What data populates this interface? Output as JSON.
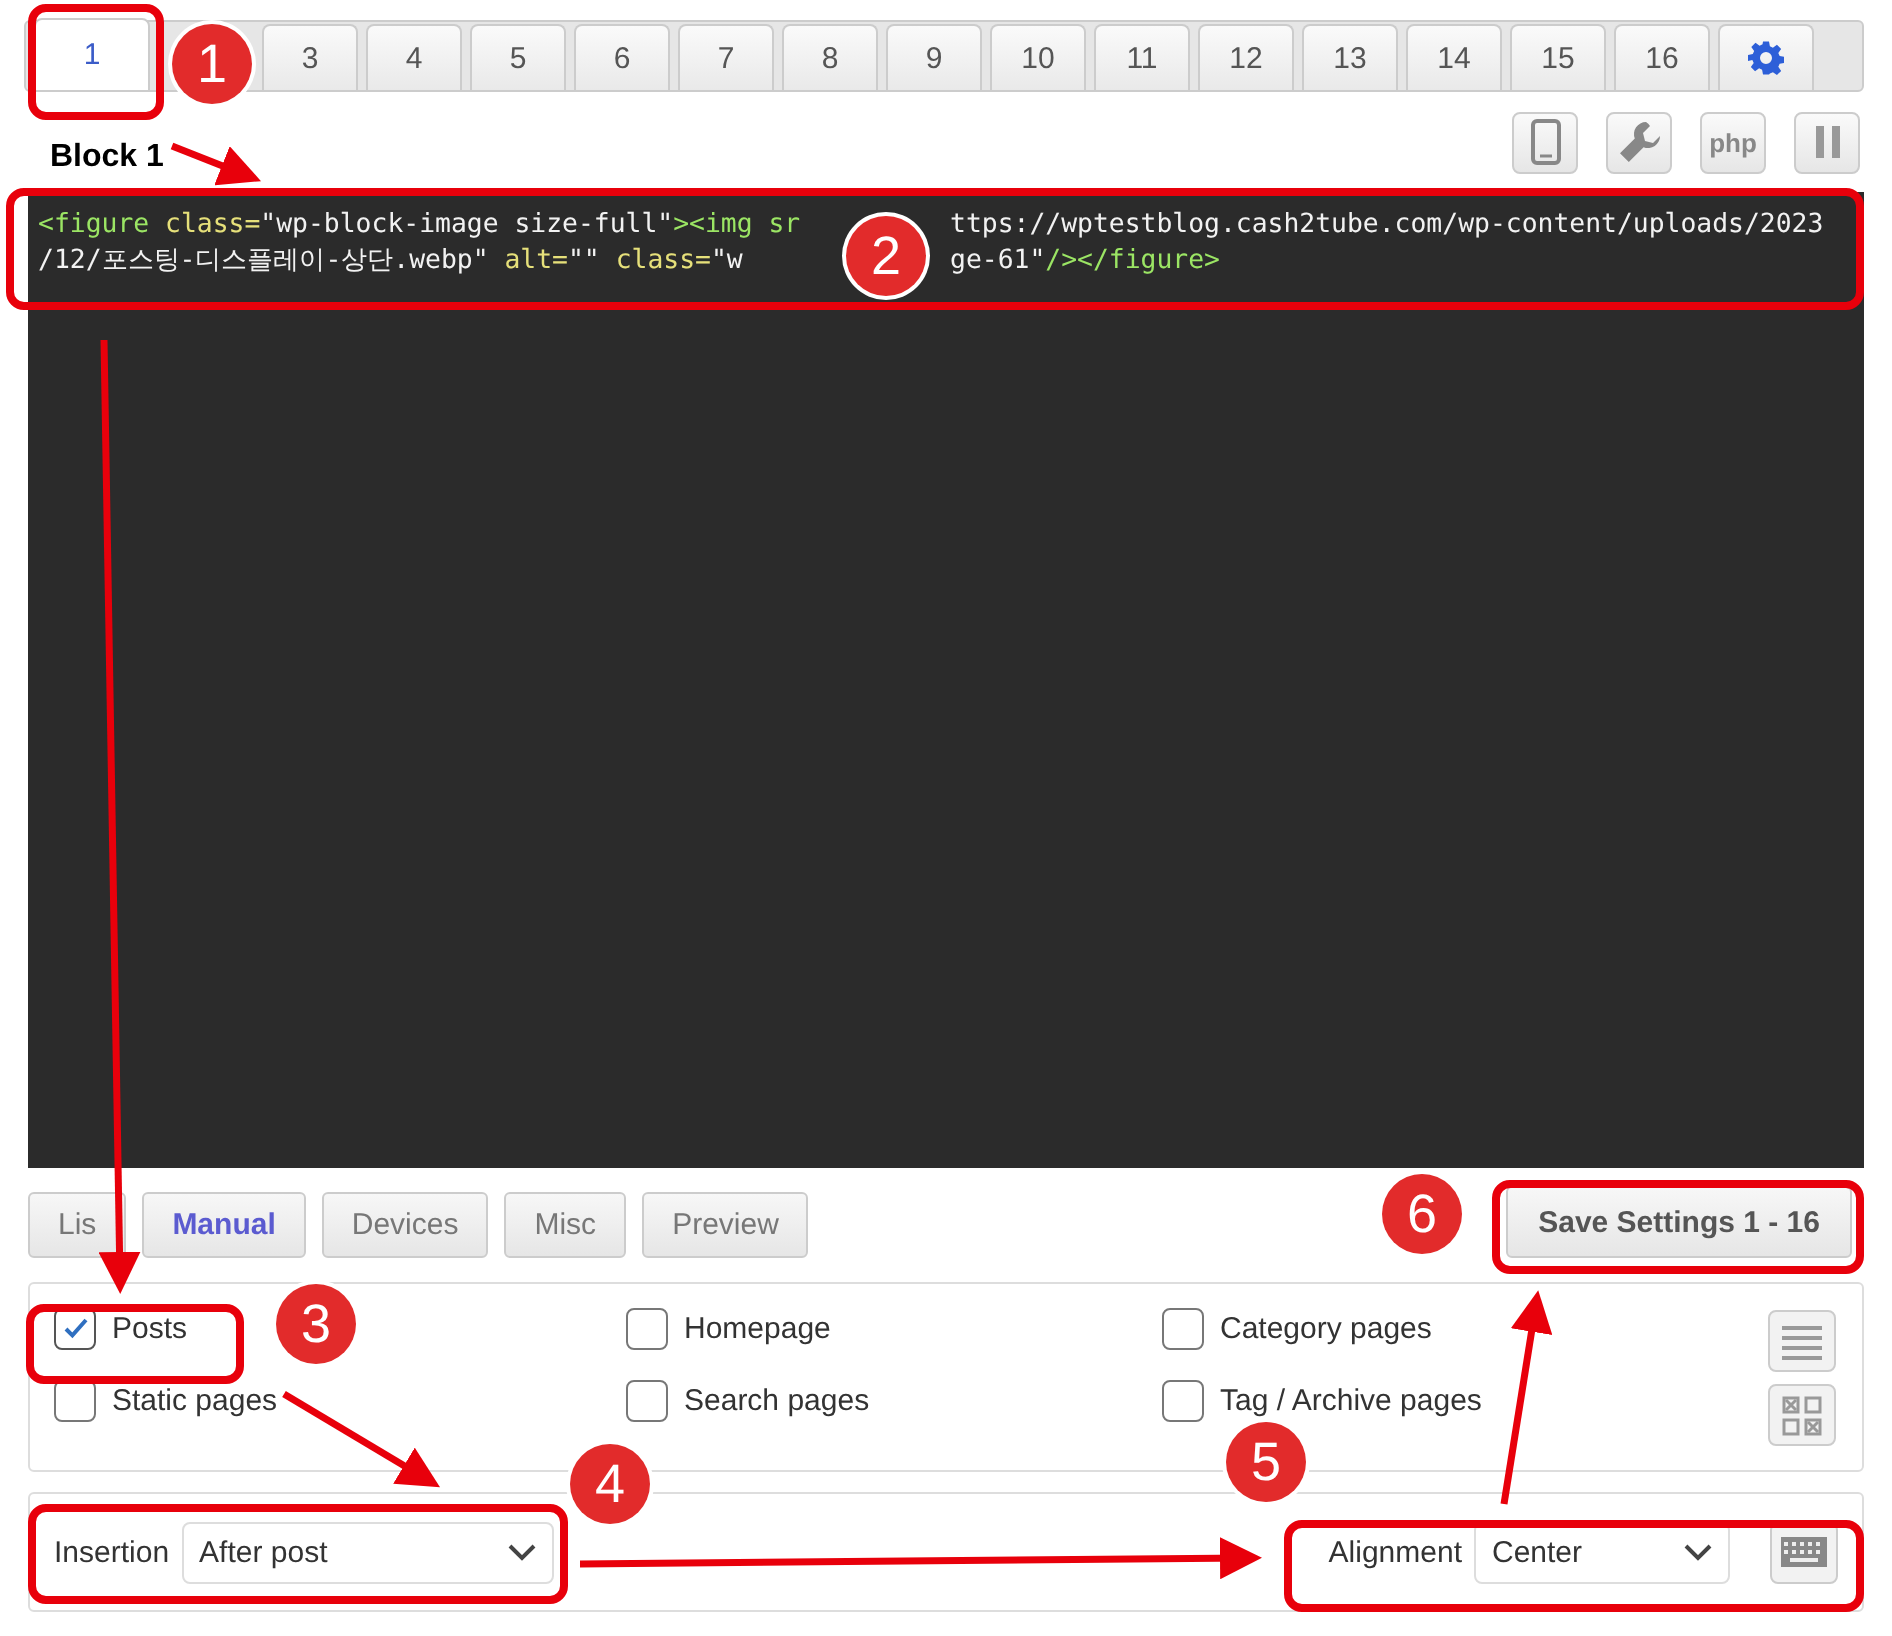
{
  "tabs": [
    {
      "label": "1",
      "selected": true,
      "kind": "number"
    },
    {
      "label": "3",
      "selected": false,
      "kind": "number"
    },
    {
      "label": "4",
      "selected": false,
      "kind": "number"
    },
    {
      "label": "5",
      "selected": false,
      "kind": "number"
    },
    {
      "label": "6",
      "selected": false,
      "kind": "number"
    },
    {
      "label": "7",
      "selected": false,
      "kind": "number"
    },
    {
      "label": "8",
      "selected": false,
      "kind": "number"
    },
    {
      "label": "9",
      "selected": false,
      "kind": "number"
    },
    {
      "label": "10",
      "selected": false,
      "kind": "number"
    },
    {
      "label": "11",
      "selected": false,
      "kind": "number"
    },
    {
      "label": "12",
      "selected": false,
      "kind": "number"
    },
    {
      "label": "13",
      "selected": false,
      "kind": "number"
    },
    {
      "label": "14",
      "selected": false,
      "kind": "number"
    },
    {
      "label": "15",
      "selected": false,
      "kind": "number"
    },
    {
      "label": "16",
      "selected": false,
      "kind": "number"
    },
    {
      "selected": false,
      "kind": "settings"
    }
  ],
  "block_title": "Block 1",
  "tool_buttons": [
    {
      "kind": "tablet"
    },
    {
      "kind": "wrench"
    },
    {
      "kind": "text",
      "label": "php"
    },
    {
      "kind": "pause"
    }
  ],
  "code_lines": [
    [
      {
        "kind": "tag",
        "text": "<figure "
      },
      {
        "kind": "attr",
        "text": "class="
      },
      {
        "kind": "string",
        "text": "\"wp-block-image size-full\""
      },
      {
        "kind": "tag",
        "text": "><img sr"
      },
      {
        "kind": "gap"
      },
      {
        "kind": "string",
        "text": "ttps://wptestblog.cash2tube.com/wp-content/uploads/2023"
      }
    ],
    [
      {
        "kind": "string",
        "text": "/12/포스팅-디스플레이-상단.webp\" "
      },
      {
        "kind": "attr",
        "text": "alt="
      },
      {
        "kind": "string",
        "text": "\"\" "
      },
      {
        "kind": "attr",
        "text": "class="
      },
      {
        "kind": "string",
        "text": "\"w"
      },
      {
        "kind": "gap"
      },
      {
        "kind": "string",
        "text": "ge-61\""
      },
      {
        "kind": "tag",
        "text": "/></figure>"
      }
    ]
  ],
  "mode_buttons": [
    {
      "label": "Lis",
      "selected": false
    },
    {
      "label": "Manual",
      "selected": true
    },
    {
      "label": "Devices",
      "selected": false
    },
    {
      "label": "Misc",
      "selected": false
    },
    {
      "label": "Preview",
      "selected": false
    }
  ],
  "save_button": "Save Settings 1 - 16",
  "checkboxes": [
    {
      "label": "Posts",
      "checked": true
    },
    {
      "label": "Homepage",
      "checked": false
    },
    {
      "label": "Category pages",
      "checked": false
    },
    {
      "label": "Static pages",
      "checked": false
    },
    {
      "label": "Search pages",
      "checked": false
    },
    {
      "label": "Tag / Archive pages",
      "checked": false
    }
  ],
  "insertion": {
    "label": "Insertion",
    "value": "After post"
  },
  "alignment": {
    "label": "Alignment",
    "value": "Center"
  },
  "annotations": [
    "1",
    "2",
    "3",
    "4",
    "5",
    "6"
  ]
}
